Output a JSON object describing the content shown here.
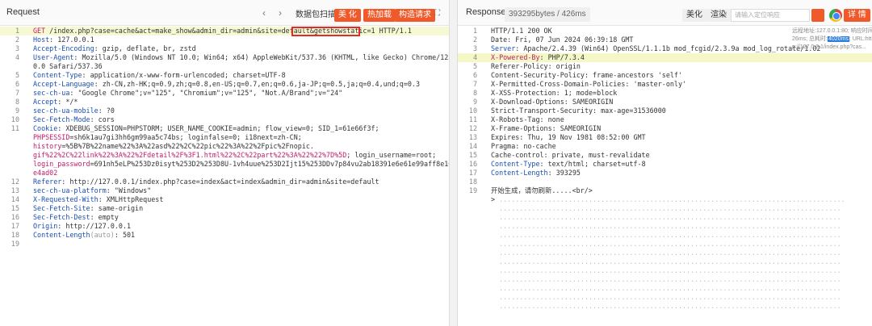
{
  "request": {
    "title": "Request",
    "buttons": {
      "scan": "数据包扫描",
      "beautify": "美 化",
      "hotload": "热加载",
      "build": "构造请求"
    },
    "lines": [
      [
        "1",
        [
          [
            "r",
            "GET"
          ],
          [
            "v",
            " /index.php?case=cache&act=make_show&admin_dir=admin&site=default&getshowstatic=1 HTTP/1.1"
          ]
        ]
      ],
      [
        "2",
        [
          [
            "k",
            "Host"
          ],
          [
            "v",
            ": 127.0.0.1"
          ]
        ]
      ],
      [
        "3",
        [
          [
            "k",
            "Accept-Encoding"
          ],
          [
            "v",
            ": gzip, deflate, br, zstd"
          ]
        ]
      ],
      [
        "4",
        [
          [
            "k",
            "User-Agent"
          ],
          [
            "v",
            ": Mozilla/5.0 (Windows NT 10.0; Win64; x64) AppleWebKit/537.36 (KHTML, like Gecko) Chrome/125.0."
          ]
        ]
      ],
      [
        "",
        [
          [
            "v",
            "0.0 Safari/537.36"
          ]
        ]
      ],
      [
        "5",
        [
          [
            "k",
            "Content-Type"
          ],
          [
            "v",
            ": application/x-www-form-urlencoded; charset=UTF-8"
          ]
        ]
      ],
      [
        "6",
        [
          [
            "k",
            "Accept-Language"
          ],
          [
            "v",
            ": zh-CN,zh-HK;q=0.9,zh;q=0.8,en-US;q=0.7,en;q=0.6,ja-JP;q=0.5,ja;q=0.4,und;q=0.3"
          ]
        ]
      ],
      [
        "7",
        [
          [
            "k",
            "sec-ch-ua"
          ],
          [
            "v",
            ": \"Google Chrome\";v=\"125\", \"Chromium\";v=\"125\", \"Not.A/Brand\";v=\"24\""
          ]
        ]
      ],
      [
        "8",
        [
          [
            "k",
            "Accept"
          ],
          [
            "v",
            ": */*"
          ]
        ]
      ],
      [
        "9",
        [
          [
            "k",
            "sec-ch-ua-mobile"
          ],
          [
            "v",
            ": ?0"
          ]
        ]
      ],
      [
        "10",
        [
          [
            "k",
            "Sec-Fetch-Mode"
          ],
          [
            "v",
            ": cors"
          ]
        ]
      ],
      [
        "11",
        [
          [
            "k",
            "Cookie"
          ],
          [
            "v",
            ": XDEBUG_SESSION=PHPSTORM; USER_NAME_COOKIE=admin; flow_view=0; SID_1=61e66f3f;"
          ]
        ]
      ],
      [
        "",
        [
          [
            "r",
            "PHPSESSID"
          ],
          [
            "v",
            "=sh6k1au7gi3hh6gm99aa5c74bs; loginfalse=0; i18next=zh-CN;"
          ]
        ]
      ],
      [
        "",
        [
          [
            "r",
            "history"
          ],
          [
            "v",
            "=%5B%7B%22name%22%3A%22asd%22%2C%22pic%22%3A%22%2Fpic%2Fnopic."
          ]
        ]
      ],
      [
        "",
        [
          [
            "r",
            "gif%22%2C%22link%22%3A%22%2Fdetail%2F%3F1.html%22%2C%22part%22%3A%22%22%7D%5D"
          ],
          [
            "v",
            "; login_username=root;"
          ]
        ]
      ],
      [
        "",
        [
          [
            "r",
            "login_password"
          ],
          [
            "v",
            "=691nh5eLP%253Dz0isyt%253D2%253D8U-1vh4uue%253D2Ijt15%253DDv7p84vu2ab18391e6e61e99aff8e10d05"
          ]
        ]
      ],
      [
        "",
        [
          [
            "r",
            "e4ad02"
          ]
        ]
      ],
      [
        "12",
        [
          [
            "k",
            "Referer"
          ],
          [
            "v",
            ": http://127.0.0.1/index.php?case=index&act=index&admin_dir=admin&site=default"
          ]
        ]
      ],
      [
        "13",
        [
          [
            "k",
            "sec-ch-ua-platform"
          ],
          [
            "v",
            ": \"Windows\""
          ]
        ]
      ],
      [
        "14",
        [
          [
            "k",
            "X-Requested-With"
          ],
          [
            "v",
            ": XMLHttpRequest"
          ]
        ]
      ],
      [
        "15",
        [
          [
            "k",
            "Sec-Fetch-Site"
          ],
          [
            "v",
            ": same-origin"
          ]
        ]
      ],
      [
        "16",
        [
          [
            "k",
            "Sec-Fetch-Dest"
          ],
          [
            "v",
            ": empty"
          ]
        ]
      ],
      [
        "17",
        [
          [
            "k",
            "Origin"
          ],
          [
            "v",
            ": http://127.0.0.1"
          ]
        ]
      ],
      [
        "18",
        [
          [
            "k",
            "Content-Length"
          ],
          [
            "gray",
            "(auto)"
          ],
          [
            "v",
            ": 501"
          ]
        ]
      ],
      [
        "19",
        []
      ]
    ]
  },
  "response": {
    "title": "Responses",
    "stats": "393295bytes / 426ms",
    "buttons": {
      "beautify": "美化",
      "render": "渲染",
      "details": "详 情"
    },
    "search_placeholder": "请输入定位响应",
    "meta": {
      "line1": "远程地址:127.0.0.1:80; 响应时间:4",
      "line2_pre": "26ms; 总耗时:",
      "line2_sel": "4020ms",
      "line2_post": "; URL:htt",
      "line3": "p://127.0.0.1/index.php?cas..."
    },
    "lines": [
      [
        "1",
        [
          [
            "v",
            "HTTP/1.1 200 OK"
          ]
        ]
      ],
      [
        "2",
        [
          [
            "v",
            "Date: Fri, 07 Jun 2024 06:39:18 GMT"
          ]
        ]
      ],
      [
        "3",
        [
          [
            "k",
            "Server"
          ],
          [
            "v",
            ": Apache/2.4.39 (Win64) OpenSSL/1.1.1b mod_fcgid/2.3.9a mod_log_rotate/1.02"
          ]
        ]
      ],
      [
        "4",
        [
          [
            "r",
            "X-Powered-By"
          ],
          [
            "v",
            ": PHP/7.3.4"
          ]
        ]
      ],
      [
        "5",
        [
          [
            "v",
            "Referer-Policy: origin"
          ]
        ]
      ],
      [
        "6",
        [
          [
            "v",
            "Content-Security-Policy: frame-ancestors 'self'"
          ]
        ]
      ],
      [
        "7",
        [
          [
            "v",
            "X-Permitted-Cross-Domain-Policies: 'master-only'"
          ]
        ]
      ],
      [
        "8",
        [
          [
            "v",
            "X-XSS-Protection: 1; mode=block"
          ]
        ]
      ],
      [
        "9",
        [
          [
            "v",
            "X-Download-Options: SAMEORIGIN"
          ]
        ]
      ],
      [
        "10",
        [
          [
            "v",
            "Strict-Transport-Security: max-age=31536000"
          ]
        ]
      ],
      [
        "11",
        [
          [
            "v",
            "X-Robots-Tag: none"
          ]
        ]
      ],
      [
        "12",
        [
          [
            "v",
            "X-Frame-Options: SAMEORIGIN"
          ]
        ]
      ],
      [
        "13",
        [
          [
            "v",
            "Expires: Thu, 19 Nov 1981 08:52:00 GMT"
          ]
        ]
      ],
      [
        "14",
        [
          [
            "v",
            "Pragma: no-cache"
          ]
        ]
      ],
      [
        "15",
        [
          [
            "v",
            "Cache-control: private, must-revalidate"
          ]
        ]
      ],
      [
        "16",
        [
          [
            "k",
            "Content-Type"
          ],
          [
            "v",
            ": text/html; charset=utf-8"
          ]
        ]
      ],
      [
        "17",
        [
          [
            "k",
            "Content-Length"
          ],
          [
            "v",
            ": 393295"
          ]
        ]
      ],
      [
        "18",
        []
      ],
      [
        "19",
        [
          [
            "v",
            "开始生成，请勿刷新.....<br/>"
          ]
        ]
      ],
      [
        "",
        [
          [
            "v",
            "> "
          ],
          [
            "dots",
            "....................................................................................."
          ]
        ]
      ],
      [
        "",
        [
          [
            "dots",
            "  ...................................................................................."
          ]
        ]
      ],
      [
        "",
        [
          [
            "dots",
            "  ...................................................................................."
          ]
        ]
      ],
      [
        "",
        [
          [
            "dots",
            "  ...................................................................................."
          ]
        ]
      ],
      [
        "",
        [
          [
            "dots",
            "  ...................................................................................."
          ]
        ]
      ],
      [
        "",
        [
          [
            "dots",
            "  ...................................................................................."
          ]
        ]
      ],
      [
        "",
        [
          [
            "dots",
            "  ...................................................................................."
          ]
        ]
      ],
      [
        "",
        [
          [
            "dots",
            "  ...................................................................................."
          ]
        ]
      ],
      [
        "",
        [
          [
            "dots",
            "  ...................................................................................."
          ]
        ]
      ],
      [
        "",
        [
          [
            "dots",
            "  ...................................................................................."
          ]
        ]
      ],
      [
        "",
        [
          [
            "dots",
            "  ...................................................................................."
          ]
        ]
      ],
      [
        "",
        [
          [
            "dots",
            "  ...................................................................................."
          ]
        ]
      ],
      [
        "",
        [
          [
            "dots",
            "  ...................................................................................."
          ]
        ]
      ]
    ]
  }
}
